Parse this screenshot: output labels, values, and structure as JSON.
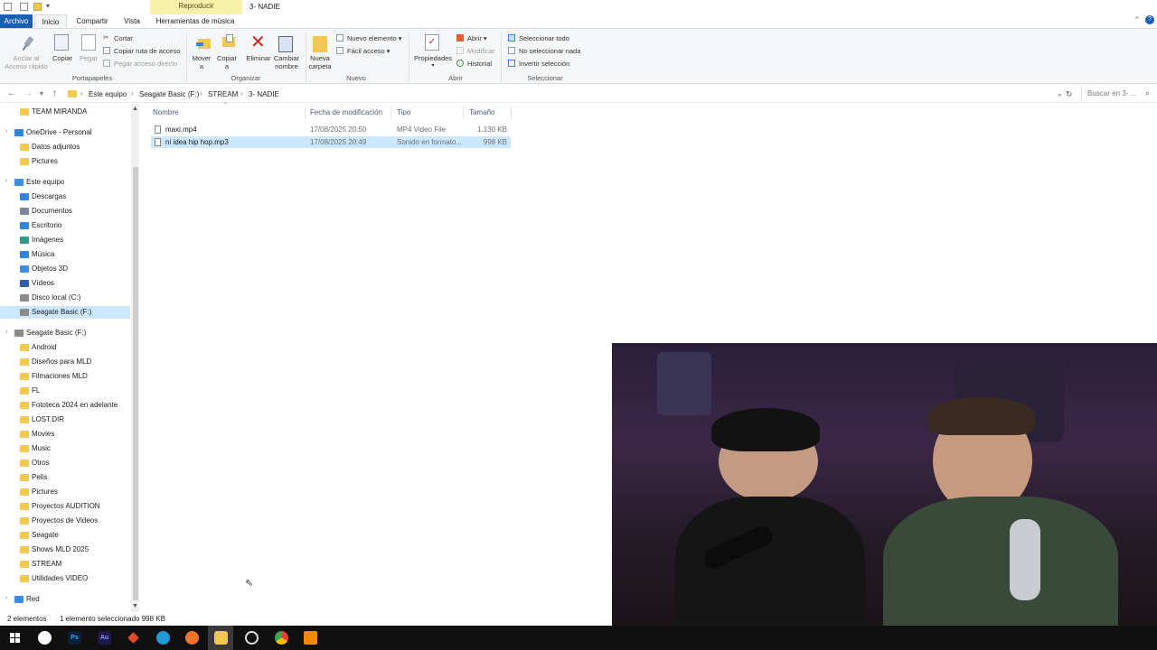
{
  "window": {
    "title": "3- NADIE",
    "context_tab": "Reproducir"
  },
  "ribbon_tabs": [
    "Archivo",
    "Inicio",
    "Compartir",
    "Vista",
    "Herramientas de música"
  ],
  "ribbon": {
    "portapapeles": {
      "group": "Portapapeles",
      "anclar": "Anclar al",
      "anclar2": "Acceso rápido",
      "copiar": "Copiar",
      "pegar": "Pegar",
      "cortar": "Cortar",
      "copiar_ruta": "Copiar ruta de acceso",
      "pegar_acceso": "Pegar acceso directo"
    },
    "organizar": {
      "group": "Organizar",
      "mover": "Mover",
      "mover2": "a",
      "copiar": "Copiar",
      "copiar2": "a",
      "eliminar": "Eliminar",
      "cambiar": "Cambiar",
      "cambiar2": "nombre"
    },
    "nuevo": {
      "group": "Nuevo",
      "nueva": "Nueva",
      "nueva2": "carpeta",
      "nuevo_elemento": "Nuevo elemento",
      "facil_acceso": "Fácil acceso"
    },
    "abrir": {
      "group": "Abrir",
      "propiedades": "Propiedades",
      "abrir": "Abrir",
      "modificar": "Modificar",
      "historial": "Historial"
    },
    "seleccionar": {
      "group": "Seleccionar",
      "todo": "Seleccionar todo",
      "nada": "No seleccionar nada",
      "invertir": "Invertir selección"
    }
  },
  "address": {
    "crumbs": [
      "Este equipo",
      "Seagate Basic (F:)",
      "STREAM",
      "3- NADIE"
    ],
    "search_placeholder": "Buscar en 3- ..."
  },
  "nav": [
    {
      "label": "TEAM MIRANDA",
      "indent": 1,
      "icon": "folder"
    },
    {
      "label": "OneDrive - Personal",
      "indent": 0,
      "icon": "cloud"
    },
    {
      "label": "Datos adjuntos",
      "indent": 1,
      "icon": "folder"
    },
    {
      "label": "Pictures",
      "indent": 1,
      "icon": "folder"
    },
    {
      "label": "Este equipo",
      "indent": 0,
      "icon": "pc"
    },
    {
      "label": "Descargas",
      "indent": 1,
      "icon": "download"
    },
    {
      "label": "Documentos",
      "indent": 1,
      "icon": "doc"
    },
    {
      "label": "Escritorio",
      "indent": 1,
      "icon": "desktop"
    },
    {
      "label": "Imágenes",
      "indent": 1,
      "icon": "image"
    },
    {
      "label": "Música",
      "indent": 1,
      "icon": "music"
    },
    {
      "label": "Objetos 3D",
      "indent": 1,
      "icon": "cube"
    },
    {
      "label": "Vídeos",
      "indent": 1,
      "icon": "video"
    },
    {
      "label": "Disco local (C:)",
      "indent": 1,
      "icon": "drive"
    },
    {
      "label": "Seagate Basic (F:)",
      "indent": 1,
      "icon": "drive",
      "selected": true
    },
    {
      "label": "Seagate Basic (F:)",
      "indent": 0,
      "icon": "drive"
    },
    {
      "label": "Android",
      "indent": 1,
      "icon": "folder"
    },
    {
      "label": "Diseños para MLD",
      "indent": 1,
      "icon": "folder"
    },
    {
      "label": "Filmaciones MLD",
      "indent": 1,
      "icon": "folder"
    },
    {
      "label": "FL",
      "indent": 1,
      "icon": "folder"
    },
    {
      "label": "Fototeca 2024 en adelante",
      "indent": 1,
      "icon": "folder"
    },
    {
      "label": "LOST.DIR",
      "indent": 1,
      "icon": "folder"
    },
    {
      "label": "Movies",
      "indent": 1,
      "icon": "folder"
    },
    {
      "label": "Music",
      "indent": 1,
      "icon": "folder"
    },
    {
      "label": "Otros",
      "indent": 1,
      "icon": "folder"
    },
    {
      "label": "Pelis",
      "indent": 1,
      "icon": "folder"
    },
    {
      "label": "Pictures",
      "indent": 1,
      "icon": "folder"
    },
    {
      "label": "Proyectos AUDITION",
      "indent": 1,
      "icon": "folder"
    },
    {
      "label": "Proyectos de Videos",
      "indent": 1,
      "icon": "folder"
    },
    {
      "label": "Seagate",
      "indent": 1,
      "icon": "folder"
    },
    {
      "label": "Shows MLD 2025",
      "indent": 1,
      "icon": "folder"
    },
    {
      "label": "STREAM",
      "indent": 1,
      "icon": "folder"
    },
    {
      "label": "Utilidades VIDEO",
      "indent": 1,
      "icon": "folder"
    },
    {
      "label": "Red",
      "indent": 0,
      "icon": "network"
    }
  ],
  "columns": [
    "Nombre",
    "Fecha de modificación",
    "Tipo",
    "Tamaño"
  ],
  "files": [
    {
      "name": "maxi.mp4",
      "date": "17/08/2025 20:50",
      "type": "MP4 Video File",
      "size": "1.130 KB",
      "selected": false
    },
    {
      "name": "ni idea hip hop.mp3",
      "date": "17/08/2025 20:49",
      "type": "Sonido en formato...",
      "size": "998 KB",
      "selected": true
    }
  ],
  "status": {
    "count": "2 elementos",
    "selection": "1 elemento seleccionado  998 KB"
  },
  "taskbar_apps": [
    "windows-start",
    "obs",
    "photoshop",
    "audition",
    "app-red",
    "edge",
    "firefox",
    "file-explorer",
    "obs-studio",
    "chrome",
    "vlc"
  ],
  "colors": {
    "accent": "#1a5fb4",
    "selection": "#cce8ff",
    "context_tab": "#f8f0a8",
    "delete_red": "#d42020",
    "folder": "#f2c94c"
  }
}
